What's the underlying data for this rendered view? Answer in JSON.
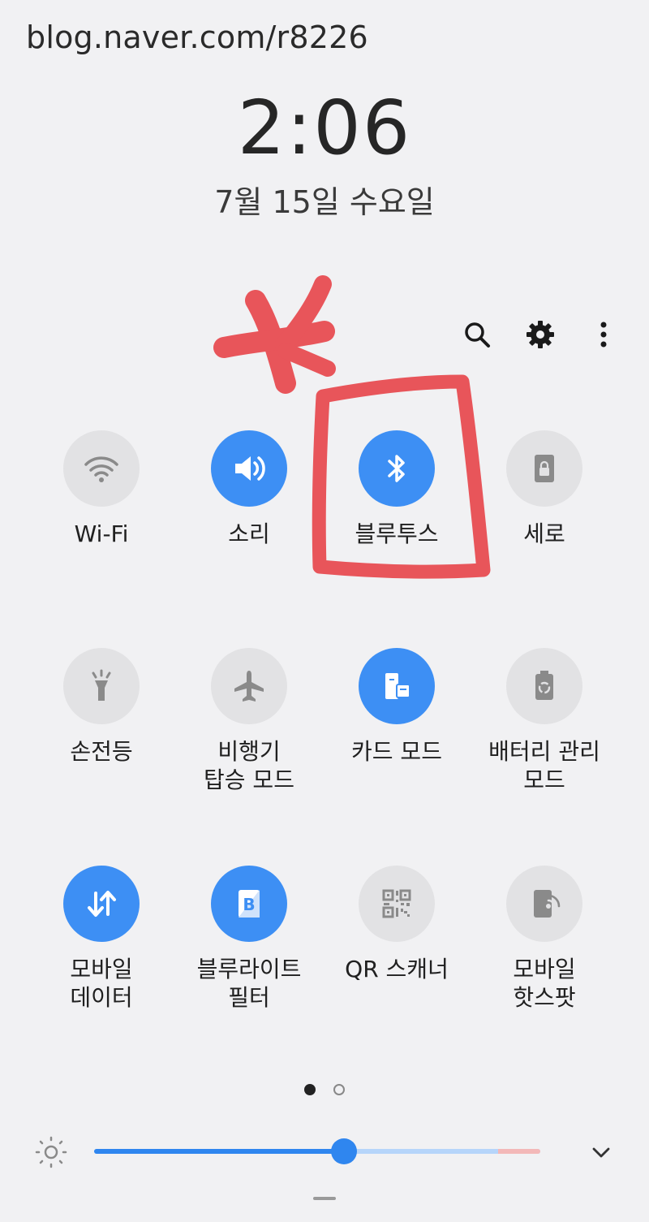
{
  "watermark": "blog.naver.com/r8226",
  "lockscreen": {
    "time": "2:06",
    "date": "7월 15일 수요일"
  },
  "toolbar": [
    {
      "name": "search-icon"
    },
    {
      "name": "gear-icon"
    },
    {
      "name": "more-vertical-icon"
    }
  ],
  "tiles": [
    {
      "label": "Wi-Fi",
      "icon": "wifi-icon",
      "active": false
    },
    {
      "label": "소리",
      "icon": "speaker-icon",
      "active": true
    },
    {
      "label": "블루투스",
      "icon": "bluetooth-icon",
      "active": true
    },
    {
      "label": "세로",
      "icon": "rotation-lock-icon",
      "active": false
    },
    {
      "label": "손전등",
      "icon": "flashlight-icon",
      "active": false
    },
    {
      "label": "비행기\n탑승 모드",
      "icon": "airplane-icon",
      "active": false
    },
    {
      "label": "카드 모드",
      "icon": "card-icon",
      "active": true
    },
    {
      "label": "배터리 관리\n모드",
      "icon": "battery-recycle-icon",
      "active": false
    },
    {
      "label": "모바일\n데이터",
      "icon": "data-arrows-icon",
      "active": true
    },
    {
      "label": "블루라이트\n필터",
      "icon": "bluelight-filter-icon",
      "active": true
    },
    {
      "label": "QR 스캐너",
      "icon": "qr-code-icon",
      "active": false
    },
    {
      "label": "모바일\n핫스팟",
      "icon": "hotspot-icon",
      "active": false
    }
  ],
  "pager": {
    "pages": 2,
    "current": 1
  },
  "brightness": {
    "level": 0.56
  },
  "colors": {
    "accent": "#3d8ff4",
    "annotation": "#e8555a",
    "tile_off": "#e2e2e4"
  }
}
